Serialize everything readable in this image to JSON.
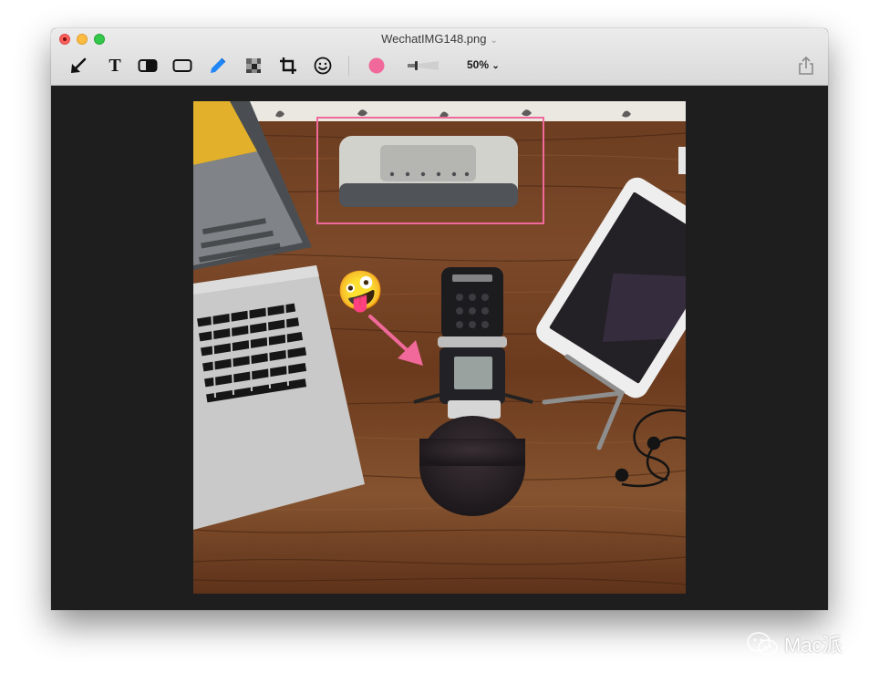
{
  "window": {
    "title": "WechatIMG148.png",
    "title_menu_icon": "chevron-down-icon"
  },
  "toolbar": {
    "tools": [
      {
        "name": "arrow-tool",
        "icon": "arrow-icon"
      },
      {
        "name": "text-tool",
        "icon": "text-icon",
        "label": "T"
      },
      {
        "name": "highlight-tool",
        "icon": "highlight-icon"
      },
      {
        "name": "rectangle-tool",
        "icon": "rectangle-icon"
      },
      {
        "name": "pen-tool",
        "icon": "pen-icon",
        "selected": true
      },
      {
        "name": "mosaic-tool",
        "icon": "mosaic-icon"
      },
      {
        "name": "crop-tool",
        "icon": "crop-icon"
      },
      {
        "name": "emoji-tool",
        "icon": "smiley-icon"
      }
    ],
    "color": "#f0699a",
    "zoom": "50%",
    "share_icon": "share-icon"
  },
  "annotations": {
    "emoji": "🤪",
    "stroke_color": "#f0699a"
  },
  "watermark": {
    "text": "Mac派",
    "icon": "wechat-icon"
  }
}
